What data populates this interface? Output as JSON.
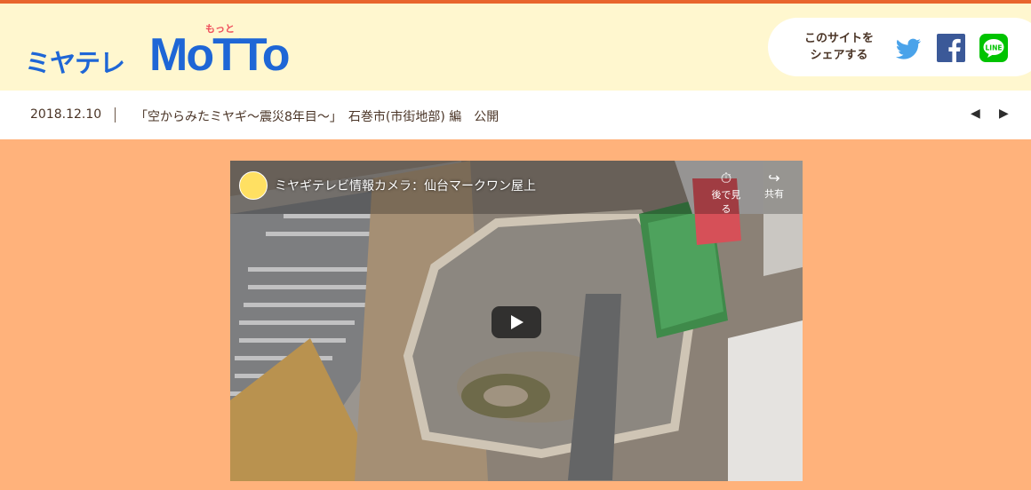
{
  "header": {
    "logo_jp": "ミヤテレ",
    "logo_en": "MoTTo",
    "logo_ruby": "もっと",
    "share_label_line1": "このサイトを",
    "share_label_line2": "シェアする",
    "sns": [
      "twitter-icon",
      "facebook-icon",
      "line-icon"
    ],
    "line_text": "LINE"
  },
  "news": {
    "date": "2018.12.10",
    "text": "「空からみたミヤギ〜震災8年目〜」　石巻市(市街地部) 編　公開",
    "prev": "◀",
    "next": "▶"
  },
  "video": {
    "title": "ミヤギテレビ情報カメラ：仙台マークワン屋上",
    "later_label": "後で見る",
    "share_label": "共有"
  },
  "colors": {
    "accent": "#e8652d",
    "header_bg": "#fff7cf",
    "page_bg": "#ffb27b",
    "logo_blue": "#1e66d6",
    "text": "#4a3426"
  }
}
